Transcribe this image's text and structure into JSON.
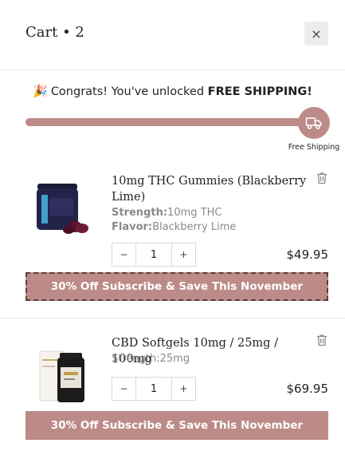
{
  "cart": {
    "title": "Cart • 2",
    "close_label": "×"
  },
  "shipping": {
    "prefix": "Congrats! You've unlocked",
    "highlight": "FREE SHIPPING!",
    "progress": 1.0,
    "goal_label": "Free Shipping"
  },
  "items": [
    {
      "name": "10mg THC Gummies (Blackberry Lime)",
      "strength_label": "Strength:",
      "strength": "10mg THC",
      "flavor_label": "Flavor:",
      "flavor": "Blackberry Lime",
      "quantity": "1",
      "price": "$49.95",
      "subscribe": "30% Off Subscribe & Save This November"
    },
    {
      "name": "CBD Softgels 10mg / 25mg / 100mg",
      "strength_text": "Strength:25mg",
      "quantity": "1",
      "price": "$69.95",
      "subscribe": "30% Off Subscribe & Save This November"
    }
  ],
  "colors": {
    "accent": "#bc8b87",
    "track": "#e9d9d7",
    "dash": "#5b3b39"
  },
  "icons": [
    "close-icon",
    "party-popper-icon",
    "truck-icon",
    "trash-icon",
    "minus-icon",
    "plus-icon"
  ]
}
